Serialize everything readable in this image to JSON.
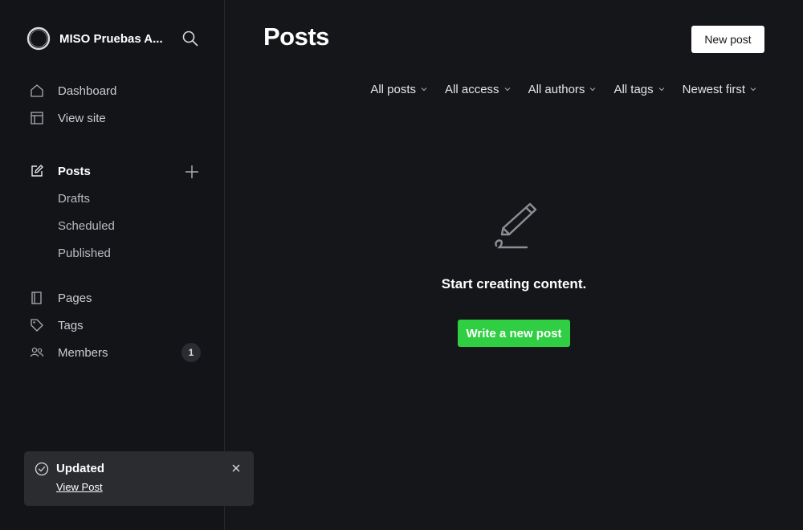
{
  "sidebar": {
    "site_name": "MISO Pruebas A...",
    "logo_icon": "circle-logo-icon",
    "search_icon": "search-icon",
    "primary": [
      {
        "label": "Dashboard",
        "icon": "home-icon"
      },
      {
        "label": "View site",
        "icon": "layout-icon"
      }
    ],
    "posts": {
      "label": "Posts",
      "icon": "pencil-square-icon",
      "sub": [
        "Drafts",
        "Scheduled",
        "Published"
      ]
    },
    "secondary": [
      {
        "label": "Pages",
        "icon": "page-icon"
      },
      {
        "label": "Tags",
        "icon": "tag-icon"
      },
      {
        "label": "Members",
        "icon": "members-icon",
        "count": "1"
      }
    ]
  },
  "main": {
    "title": "Posts",
    "new_post_label": "New post",
    "filters": [
      "All posts",
      "All access",
      "All authors",
      "All tags",
      "Newest first"
    ],
    "empty_state": {
      "icon": "pen-icon",
      "title": "Start creating content.",
      "button": "Write a new post"
    }
  },
  "toast": {
    "title": "Updated",
    "link": "View Post"
  },
  "colors": {
    "background": "#151619",
    "sidebar": "#131417",
    "accent_green": "#30cf43",
    "toast_bg": "#2a2c30"
  }
}
